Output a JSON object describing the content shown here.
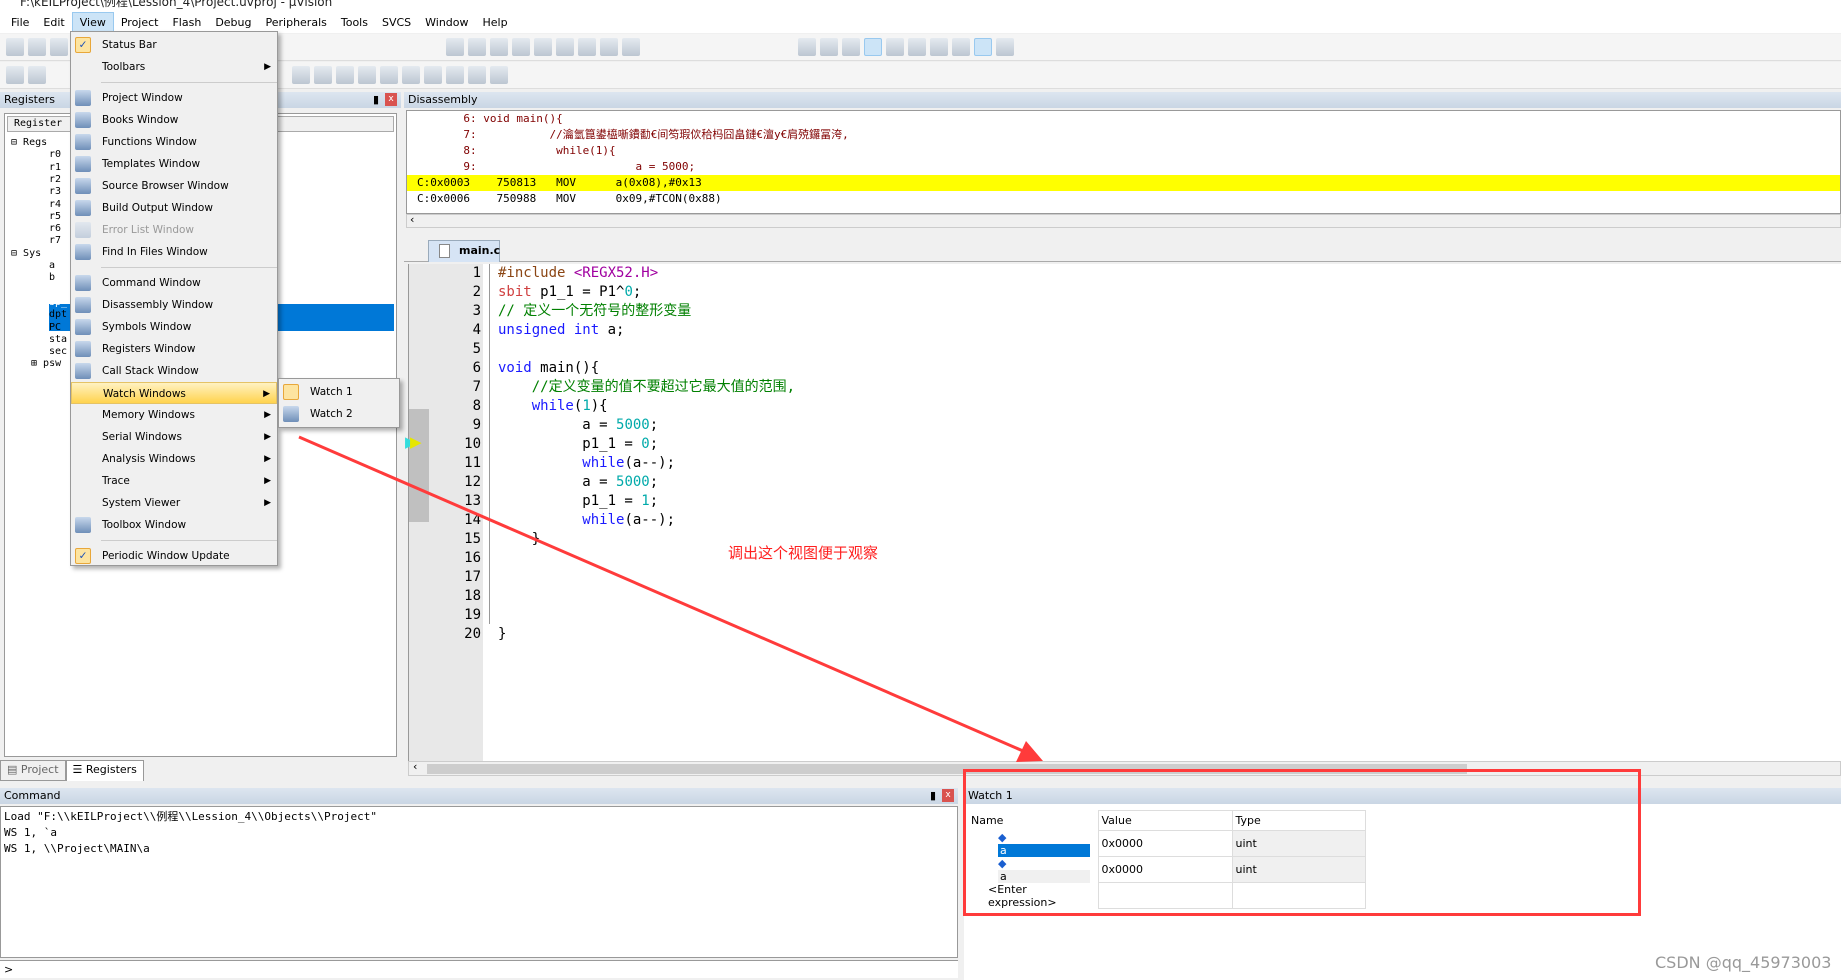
{
  "window": {
    "title": "F:\\kEILProject\\例程\\Lession_4\\Project.uvproj - µVision"
  },
  "menubar": [
    "File",
    "Edit",
    "View",
    "Project",
    "Flash",
    "Debug",
    "Peripherals",
    "Tools",
    "SVCS",
    "Window",
    "Help"
  ],
  "menubar_active": "View",
  "toolbar1_icons": [
    "new-file-icon",
    "open-icon",
    "save-icon",
    "",
    "",
    "",
    "",
    "",
    "",
    "",
    "",
    "",
    "",
    "",
    "",
    "",
    "",
    "",
    "",
    "",
    "bookmark-icon",
    "prev-bookmark-icon",
    "next-bookmark-icon",
    "clear-bookmarks-icon",
    "indent-icon",
    "unindent-icon",
    "comment-icon",
    "uncomment-icon",
    "find-in-files-icon"
  ],
  "toolbar1_right_icons": [
    "dropdown-icon",
    "browse-icon",
    "find-icon",
    "debug-session-icon",
    "breakpoint-icon",
    "disable-breakpoint-icon",
    "kill-breakpoints-icon",
    "kill-all-icon",
    "window-layout-icon",
    "configure-icon"
  ],
  "toolbar2_icons": [
    "reset-icon",
    "step-icon",
    "",
    "",
    "",
    "",
    "",
    "",
    "",
    "",
    "",
    "",
    "",
    "symbols-window-icon",
    "registers-window-icon",
    "call-stack-icon",
    "watch-window-icon",
    "memory-window-icon",
    "serial-window-icon",
    "analysis-window-icon",
    "trace-icon",
    "system-viewer-icon",
    "toolbox-icon"
  ],
  "registers": {
    "title": "Registers",
    "column": "Register",
    "tree": [
      {
        "label": "Regs",
        "level": 0,
        "exp": "-"
      },
      {
        "label": "r0",
        "level": 2
      },
      {
        "label": "r1",
        "level": 2
      },
      {
        "label": "r2",
        "level": 2
      },
      {
        "label": "r3",
        "level": 2
      },
      {
        "label": "r4",
        "level": 2
      },
      {
        "label": "r5",
        "level": 2
      },
      {
        "label": "r6",
        "level": 2
      },
      {
        "label": "r7",
        "level": 2
      },
      {
        "label": "Sys",
        "level": 0,
        "exp": "-"
      },
      {
        "label": "a",
        "level": 2
      },
      {
        "label": "b",
        "level": 2
      },
      {
        "label": "sp",
        "level": 2,
        "sel": true
      },
      {
        "label": "sp_",
        "level": 2,
        "sel": true
      },
      {
        "label": "dpt",
        "level": 2
      },
      {
        "label": "PC",
        "level": 2
      },
      {
        "label": "sta",
        "level": 2
      },
      {
        "label": "sec",
        "level": 2
      },
      {
        "label": "psw",
        "level": 2,
        "exp": "+"
      }
    ],
    "tabs": [
      "Project",
      "Registers"
    ],
    "active_tab": "Registers"
  },
  "disassembly": {
    "title": "Disassembly",
    "lines": [
      {
        "text": "       6: void main(){",
        "type": "src"
      },
      {
        "text": "       7:           //瀹氫箟鍙橀噺鐨勫€间笉瑕佽秴杩囧畠鏈€澶у€肩殑鑼冨洿,",
        "type": "src"
      },
      {
        "text": "       8:            while(1){",
        "type": "src"
      },
      {
        "text": "       9:                        a = 5000;",
        "type": "src"
      },
      {
        "text": "C:0x0003    750813   MOV      a(0x08),#0x13",
        "type": "asm",
        "current": true
      },
      {
        "text": "C:0x0006    750988   MOV      0x09,#TCON(0x88)",
        "type": "asm"
      }
    ]
  },
  "editor": {
    "tab": "main.c",
    "lines": [
      [
        [
          "#include ",
          "pp"
        ],
        [
          "<REGX52.H>",
          "inc"
        ]
      ],
      [
        [
          "sbit",
          "kw2"
        ],
        [
          " p1_1 = P1^",
          "tx"
        ],
        [
          "0",
          "num"
        ],
        [
          ";",
          "tx"
        ]
      ],
      [
        [
          "// 定义一个无符号的整形变量",
          "cm"
        ]
      ],
      [
        [
          "unsigned int",
          "kw"
        ],
        [
          " a;",
          "tx"
        ]
      ],
      [],
      [
        [
          "void",
          "kw"
        ],
        [
          " main(){",
          "tx"
        ]
      ],
      [
        [
          "    //定义变量的值不要超过它最大值的范围,",
          "cm"
        ]
      ],
      [
        [
          "    ",
          "tx"
        ],
        [
          "while",
          "kw"
        ],
        [
          "(",
          "tx"
        ],
        [
          "1",
          "num"
        ],
        [
          "){",
          "tx"
        ]
      ],
      [
        [
          "          a = ",
          "tx"
        ],
        [
          "5000",
          "num"
        ],
        [
          ";",
          "tx"
        ]
      ],
      [
        [
          "          p1_1 = ",
          "tx"
        ],
        [
          "0",
          "num"
        ],
        [
          ";",
          "tx"
        ]
      ],
      [
        [
          "          ",
          "tx"
        ],
        [
          "while",
          "kw"
        ],
        [
          "(a--);",
          "tx"
        ]
      ],
      [
        [
          "          a = ",
          "tx"
        ],
        [
          "5000",
          "num"
        ],
        [
          ";",
          "tx"
        ]
      ],
      [
        [
          "          p1_1 = ",
          "tx"
        ],
        [
          "1",
          "num"
        ],
        [
          ";",
          "tx"
        ]
      ],
      [
        [
          "          ",
          "tx"
        ],
        [
          "while",
          "kw"
        ],
        [
          "(a--);",
          "tx"
        ]
      ],
      [
        [
          "    }",
          "tx"
        ]
      ],
      [],
      [],
      [],
      [],
      [
        [
          "}",
          "tx"
        ]
      ]
    ],
    "current_line": 9
  },
  "command": {
    "title": "Command",
    "lines": [
      "Load \"F:\\\\kEILProject\\\\例程\\\\Lession_4\\\\Objects\\\\Project\"",
      "WS 1, `a",
      "WS 1, \\\\Project\\MAIN\\a"
    ],
    "prompt": ">"
  },
  "watch": {
    "title": "Watch 1",
    "columns": [
      "Name",
      "Value",
      "Type"
    ],
    "rows": [
      {
        "name": "a",
        "value": "0x0000",
        "type": "uint",
        "selected": true
      },
      {
        "name": "a",
        "value": "0x0000",
        "type": "uint"
      }
    ],
    "enter_placeholder": "<Enter expression>"
  },
  "view_menu": {
    "items": [
      {
        "label": "Status Bar",
        "icon": "check-icon",
        "checked": true
      },
      {
        "label": "Toolbars",
        "submenu": true
      },
      {
        "sep": true
      },
      {
        "label": "Project Window",
        "icon": "project-window-icon"
      },
      {
        "label": "Books Window",
        "icon": "books-icon"
      },
      {
        "label": "Functions Window",
        "icon": "functions-icon"
      },
      {
        "label": "Templates Window",
        "icon": "templates-icon"
      },
      {
        "label": "Source Browser Window",
        "icon": "source-browser-icon"
      },
      {
        "label": "Build Output Window",
        "icon": "build-output-icon"
      },
      {
        "label": "Error List Window",
        "icon": "error-list-icon",
        "disabled": true
      },
      {
        "label": "Find In Files Window",
        "icon": "find-in-files-icon"
      },
      {
        "sep": true
      },
      {
        "label": "Command Window",
        "icon": "command-window-icon"
      },
      {
        "label": "Disassembly Window",
        "icon": "disassembly-icon"
      },
      {
        "label": "Symbols Window",
        "icon": "symbols-icon"
      },
      {
        "label": "Registers Window",
        "icon": "registers-icon"
      },
      {
        "label": "Call Stack Window",
        "icon": "call-stack-icon"
      },
      {
        "label": "Watch Windows",
        "submenu": true,
        "highlighted": true
      },
      {
        "label": "Memory Windows",
        "submenu": true
      },
      {
        "label": "Serial Windows",
        "submenu": true
      },
      {
        "label": "Analysis Windows",
        "submenu": true
      },
      {
        "label": "Trace",
        "submenu": true
      },
      {
        "label": "System Viewer",
        "submenu": true
      },
      {
        "label": "Toolbox Window",
        "icon": "toolbox-icon"
      },
      {
        "sep": true
      },
      {
        "label": "Periodic Window Update",
        "icon": "check-icon",
        "checked": true
      }
    ]
  },
  "watch_submenu": [
    "Watch 1",
    "Watch 2"
  ],
  "annotation": {
    "text": "调出这个视图便于观察",
    "color": "#ff3b3b"
  },
  "watermark": "CSDN @qq_45973003",
  "colors": {
    "current_line": "#ffff00",
    "selection": "#0078d7",
    "annotation": "#ff3b3b"
  }
}
